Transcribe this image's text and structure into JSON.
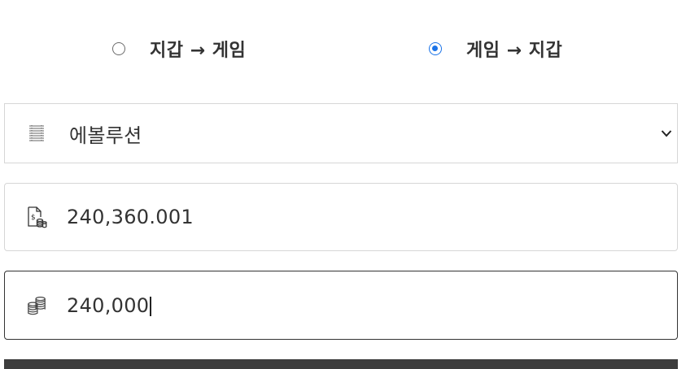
{
  "direction": {
    "options": [
      {
        "label": "지갑 → 게임",
        "selected": false
      },
      {
        "label": "게임 → 지갑",
        "selected": true
      }
    ],
    "accent_color": "#1a73e8"
  },
  "game_select": {
    "icon": "list-icon",
    "selected_value": "에볼루션"
  },
  "balance": {
    "icon": "money-document-icon",
    "value": "240,360.001"
  },
  "amount": {
    "icon": "coins-stack-icon",
    "value": "240,000"
  },
  "submit": {
    "color": "#3d3d3d"
  }
}
